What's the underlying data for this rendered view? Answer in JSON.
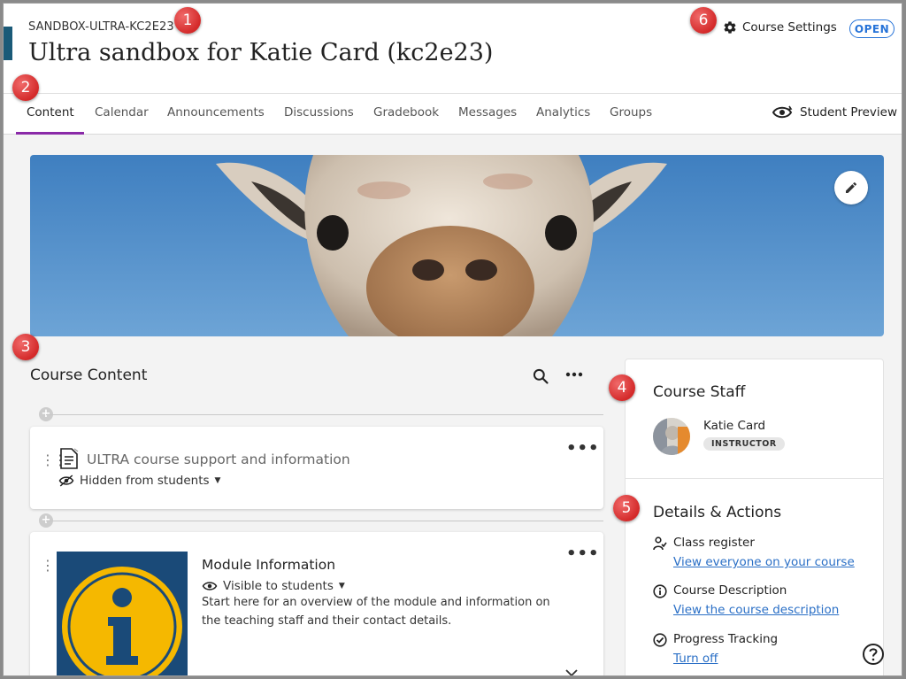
{
  "header": {
    "course_id": "SANDBOX-ULTRA-KC2E23",
    "course_title": "Ultra sandbox for Katie Card (kc2e23)",
    "settings_label": "Course Settings",
    "status": "OPEN"
  },
  "tabs": [
    {
      "label": "Content",
      "active": true
    },
    {
      "label": "Calendar"
    },
    {
      "label": "Announcements"
    },
    {
      "label": "Discussions"
    },
    {
      "label": "Gradebook"
    },
    {
      "label": "Messages"
    },
    {
      "label": "Analytics"
    },
    {
      "label": "Groups"
    }
  ],
  "student_preview_label": "Student Preview",
  "markers": [
    "1",
    "2",
    "3",
    "4",
    "5",
    "6"
  ],
  "course_content": {
    "title": "Course Content",
    "items": [
      {
        "title": "ULTRA course support and information",
        "visibility": "Hidden from students",
        "icon": "document-icon"
      },
      {
        "title": "Module Information",
        "visibility": "Visible to students",
        "description": "Start here for an overview of the module and information on the teaching staff and their contact details."
      }
    ]
  },
  "course_staff": {
    "title": "Course Staff",
    "name": "Katie Card",
    "role": "INSTRUCTOR"
  },
  "details": {
    "title": "Details & Actions",
    "actions": [
      {
        "label": "Class register",
        "link": "View everyone on your course",
        "icon": "people-icon"
      },
      {
        "label": "Course Description",
        "link": "View the course description",
        "icon": "info-icon"
      },
      {
        "label": "Progress Tracking",
        "link": "Turn off",
        "icon": "check-circle-icon"
      }
    ]
  },
  "colors": {
    "accent": "#8a2aa8",
    "link": "#2a6fc6",
    "status": "#2673d8",
    "marker": "#d42a2a",
    "module_bg": "#1a4a78",
    "module_info": "#f5b800"
  }
}
